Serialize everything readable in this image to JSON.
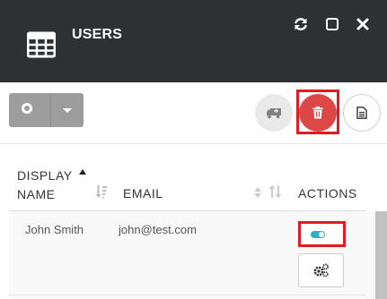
{
  "window": {
    "title": "USERS",
    "app_icon": "table-icon",
    "controls": [
      "refresh-icon",
      "maximize-icon",
      "close-icon"
    ]
  },
  "toolbar": {
    "split_button_icon": "circle-icon",
    "split_button_caret": "caret-down-icon",
    "actions": [
      {
        "icon": "truck-icon",
        "name": "move-button"
      },
      {
        "icon": "trash-icon",
        "name": "delete-button",
        "color": "#dc4848",
        "highlighted": true
      },
      {
        "icon": "document-icon",
        "name": "document-button"
      }
    ]
  },
  "table": {
    "columns": {
      "display_name_line1": "DISPLAY",
      "display_name_line2": "NAME",
      "email": "EMAIL",
      "actions": "ACTIONS"
    },
    "sort": {
      "display_name": "ascending"
    },
    "rows": [
      {
        "display_name": "John Smith",
        "email": "john@test.com",
        "enabled": true
      }
    ]
  },
  "colors": {
    "header_bg": "#2e3134",
    "delete": "#dc4848",
    "toggle_on": "#31b0c4",
    "highlight": "#e01b24"
  }
}
